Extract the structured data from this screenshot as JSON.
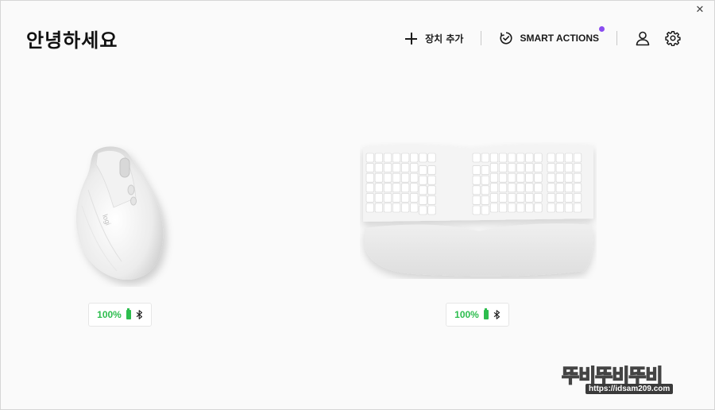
{
  "window": {
    "close_glyph": "✕"
  },
  "header": {
    "greeting": "안녕하세요",
    "add_device_label": "장치 추가",
    "smart_actions_label": "SMART ACTIONS",
    "notification_color": "#8a4cf0"
  },
  "devices": [
    {
      "type": "mouse",
      "icon": "vertical-mouse-image",
      "battery": "100%",
      "connection": "bluetooth-icon"
    },
    {
      "type": "keyboard",
      "icon": "ergonomic-keyboard-image",
      "battery": "100%",
      "connection": "bluetooth-icon"
    }
  ],
  "colors": {
    "battery_green": "#2dbd4e",
    "accent_dot": "#8a4cf0"
  },
  "watermark": {
    "brand": "뚜비뚜비뚜비",
    "url": "https://idsam209.com"
  }
}
